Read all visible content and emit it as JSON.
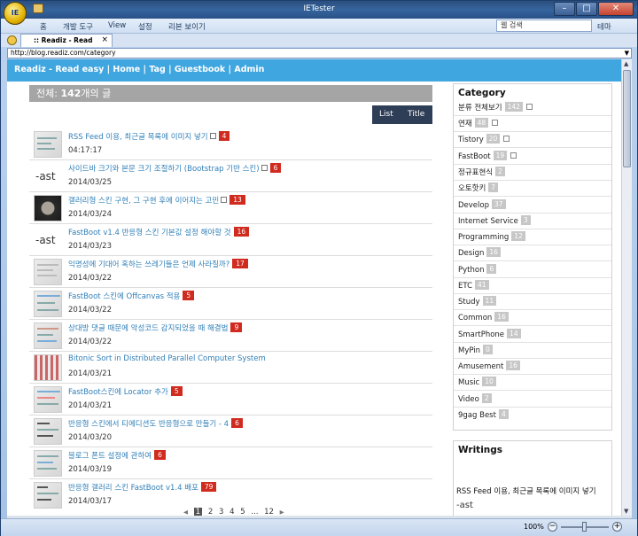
{
  "window": {
    "title": "IETester",
    "app_icon_text": "IE"
  },
  "menubar": {
    "items": [
      "홈",
      "개발 도구",
      "View",
      "설정",
      "리본 보이기"
    ],
    "search_placeholder": "웹 검색",
    "theme": "테마"
  },
  "tab": {
    "label": ":: Readiz - Read easy"
  },
  "address": {
    "url": "http://blog.readiz.com/category"
  },
  "site_nav": {
    "items": [
      "Readiz - Read easy",
      "Home",
      "Tag",
      "Guestbook",
      "Admin"
    ]
  },
  "listing": {
    "heading_prefix": "전체:",
    "count": "142",
    "heading_suffix": "개의 글",
    "view_list": "List",
    "view_title": "Title"
  },
  "posts": [
    {
      "title": "RSS Feed 이용, 최근글 목록에 이미지 넣기",
      "date": "04:17:17",
      "comments": "4"
    },
    {
      "title": "사이드바 크기와 본문 크기 조절하기 (Bootstrap 기반 스킨)",
      "date": "2014/03/25",
      "comments": "6"
    },
    {
      "title": "갤러리형 스킨 구현, 그 구현 후에 이어지는 고민",
      "date": "2014/03/24",
      "comments": "13"
    },
    {
      "title": "FastBoot v1.4 반응형 스킨 기본값 설정 해야할 것",
      "date": "2014/03/23",
      "comments": "16"
    },
    {
      "title": "익명성에 기대어 혹하는 쓰레기들은 언제 사라질까?",
      "date": "2014/03/22",
      "comments": "17"
    },
    {
      "title": "FastBoot 스킨에 Offcanvas 적용",
      "date": "2014/03/22",
      "comments": "5"
    },
    {
      "title": "상대방 댓글 때문에 악성코드 감지되었을 때 해결법",
      "date": "2014/03/22",
      "comments": "9"
    },
    {
      "title": "Bitonic Sort in Distributed Parallel Computer System",
      "date": "2014/03/21",
      "comments": ""
    },
    {
      "title": "FastBoot스킨에 Locator 추가",
      "date": "2014/03/21",
      "comments": "5"
    },
    {
      "title": "반응형 스킨에서 티에디션도 반응형으로 만들기 - 4",
      "date": "2014/03/20",
      "comments": "6"
    },
    {
      "title": "블로그 폰트 설정에 관하여",
      "date": "2014/03/19",
      "comments": "6"
    },
    {
      "title": "반응형 갤러리 스킨 FastBoot v1.4 배포",
      "date": "2014/03/17",
      "comments": "79"
    }
  ],
  "thumb_text": {
    "ast1": "-ast",
    "ast3": "-ast"
  },
  "pagination": {
    "pages": [
      "1",
      "2",
      "3",
      "4",
      "5",
      "...",
      "12"
    ],
    "current": "1"
  },
  "sidebar": {
    "category_title": "Category",
    "categories": [
      {
        "name": "분류 전체보기",
        "count": "142"
      },
      {
        "name": "연재",
        "count": "48"
      },
      {
        "name": "Tistory",
        "count": "20"
      },
      {
        "name": "FastBoot",
        "count": "19"
      },
      {
        "name": "정규표현식",
        "count": "2"
      },
      {
        "name": "오토핫키",
        "count": "7"
      },
      {
        "name": "Develop",
        "count": "37"
      },
      {
        "name": "Internet Service",
        "count": "3"
      },
      {
        "name": "Programming",
        "count": "12"
      },
      {
        "name": "Design",
        "count": "16"
      },
      {
        "name": "Python",
        "count": "6"
      },
      {
        "name": "ETC",
        "count": "41"
      },
      {
        "name": "Study",
        "count": "11"
      },
      {
        "name": "Common",
        "count": "16"
      },
      {
        "name": "SmartPhone",
        "count": "14"
      },
      {
        "name": "MyPin",
        "count": "0"
      },
      {
        "name": "Amusement",
        "count": "16"
      },
      {
        "name": "Music",
        "count": "10"
      },
      {
        "name": "Video",
        "count": "2"
      },
      {
        "name": "9gag Best",
        "count": "4"
      }
    ],
    "writings_title": "Writings",
    "writings_first": "RSS Feed 이용, 최근글 목록에 이미지 넣기",
    "writings_thumb": "-ast"
  },
  "status": {
    "zoom": "100%"
  }
}
